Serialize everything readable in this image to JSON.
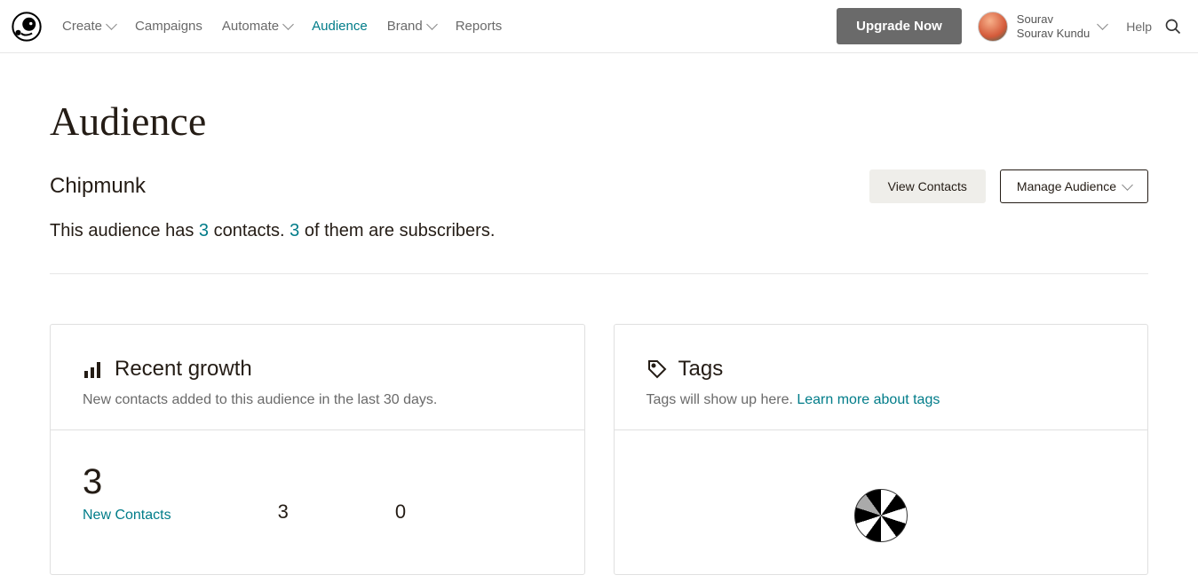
{
  "nav": {
    "create": "Create",
    "campaigns": "Campaigns",
    "automate": "Automate",
    "audience": "Audience",
    "brand": "Brand",
    "reports": "Reports"
  },
  "header": {
    "upgrade": "Upgrade Now",
    "user_first": "Sourav",
    "user_full": "Sourav Kundu",
    "help": "Help"
  },
  "page": {
    "title": "Audience",
    "audience_name": "Chipmunk",
    "view_contacts": "View Contacts",
    "manage_audience": "Manage Audience",
    "summary_pre": "This audience has ",
    "summary_contacts": "3",
    "summary_mid": " contacts. ",
    "summary_subs": "3",
    "summary_post": " of them are subscribers."
  },
  "growth": {
    "title": "Recent growth",
    "subtitle": "New contacts added to this audience in the last 30 days.",
    "big_num": "3",
    "new_contacts_label": "New Contacts",
    "stat_a": "3",
    "stat_b": "0"
  },
  "tags": {
    "title": "Tags",
    "subtitle": "Tags will show up here. ",
    "learn_more": "Learn more about tags"
  }
}
